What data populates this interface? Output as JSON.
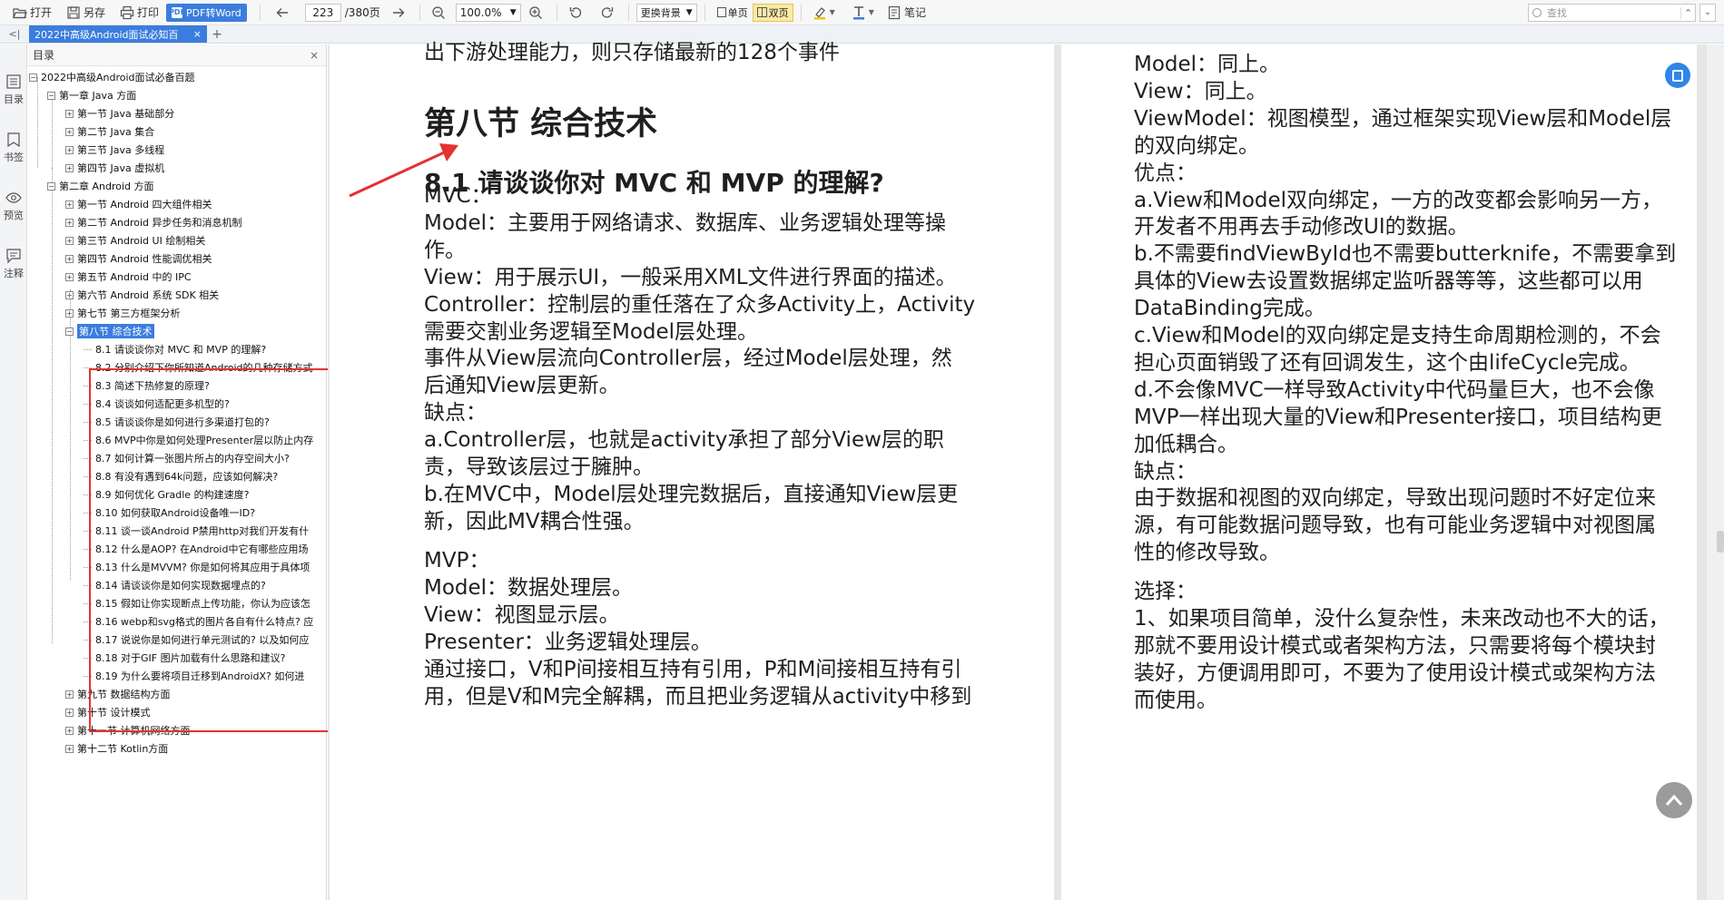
{
  "toolbar": {
    "open_label": "打开",
    "saveas_label": "另存",
    "print_label": "打印",
    "pdf_convert_label": "PDF转Word",
    "pdf_icon_text": "PDF",
    "current_page": "223",
    "total_pages": "/380页",
    "zoom": "100.0%",
    "background_label": "更换背景",
    "single_page_label": "单页",
    "double_page_label": "双页",
    "note_label": "笔记",
    "search_placeholder": "查找"
  },
  "tab": {
    "title": "2022中高级Android面试必知百",
    "close": "×",
    "new": "+"
  },
  "rail": {
    "toc": "目录",
    "bookmark": "书签",
    "preview": "预览",
    "annotate": "注释"
  },
  "toc": {
    "header": "目录",
    "close": "×",
    "root": "2022中高级Android面试必备百题",
    "chapter1": "第一章 Java 方面",
    "ch1_items": [
      "第一节 Java 基础部分",
      "第二节 Java 集合",
      "第三节 Java 多线程",
      "第四节 Java 虚拟机"
    ],
    "chapter2": "第二章 Android 方面",
    "ch2_items": [
      "第一节 Android 四大组件相关",
      "第二节 Android 异步任务和消息机制",
      "第三节 Android UI 绘制相关",
      "第四节 Android 性能调优相关",
      "第五节 Android 中的 IPC",
      "第六节 Android 系统 SDK 相关",
      "第七节 第三方框架分析"
    ],
    "section8": "第八节 综合技术",
    "sec8_items": [
      "8.1 请谈谈你对 MVC 和 MVP 的理解?",
      "8.2 分别介绍下你所知道Android的几种存储方式",
      "8.3 简述下热修复的原理?",
      "8.4 谈谈如何适配更多机型的?",
      "8.5 请谈谈你是如何进行多渠道打包的?",
      "8.6 MVP中你是如何处理Presenter层以防止内存",
      "8.7 如何计算一张图片所占的内存空间大小?",
      "8.8 有没有遇到64k问题，应该如何解决?",
      "8.9 如何优化 Gradle 的构建速度?",
      "8.10 如何获取Android设备唯一ID?",
      "8.11 谈一谈Android P禁用http对我们开发有什",
      "8.12 什么是AOP? 在Android中它有哪些应用场",
      "8.13 什么是MVVM? 你是如何将其应用于具体项",
      "8.14 请谈谈你是如何实现数据埋点的?",
      "8.15 假如让你实现断点上传功能，你认为应该怎",
      "8.16 webp和svg格式的图片各自有什么特点? 应",
      "8.17 说说你是如何进行单元测试的? 以及如何应",
      "8.18 对于GIF 图片加载有什么思路和建议?",
      "8.19 为什么要将项目迁移到AndroidX? 如何进"
    ],
    "tail_items": [
      "第九节 数据结构方面",
      "第十节 设计模式",
      "第十一节 计算机网络方面",
      "第十二节 Kotlin方面"
    ]
  },
  "left_page": {
    "top_line": "出下游处理能力，则只存储最新的128个事件",
    "section_title": "第八节 综合技术",
    "question_title": "8.1 请谈谈你对 MVC 和 MVP 的理解?",
    "lines1": [
      "MVC：",
      "Model：主要用于网络请求、数据库、业务逻辑处理等操",
      "作。",
      "View：用于展示UI，一般采用XML文件进行界面的描述。",
      "Controller：控制层的重任落在了众多Activity上，Activity",
      "需要交割业务逻辑至Model层处理。",
      "事件从View层流向Controller层，经过Model层处理，然",
      "后通知View层更新。",
      "缺点：",
      "a.Controller层，也就是activity承担了部分View层的职",
      "责，导致该层过于臃肿。",
      "b.在MVC中，Model层处理完数据后，直接通知View层更",
      "新，因此MV耦合性强。"
    ],
    "lines2": [
      "MVP：",
      "Model：数据处理层。",
      "View：视图显示层。",
      "Presenter：业务逻辑处理层。",
      "通过接口，V和P间接相互持有引用，P和M间接相互持有引",
      "用，但是V和M完全解耦，而且把业务逻辑从activity中移到"
    ]
  },
  "right_page": {
    "lines1": [
      "Model：同上。",
      "View：同上。",
      "ViewModel：视图模型，通过框架实现View层和Model层",
      "的双向绑定。",
      "优点：",
      "a.View和Model双向绑定，一方的改变都会影响另一方，",
      "开发者不用再去手动修改UI的数据。",
      "b.不需要findViewById也不需要butterknife，不需要拿到",
      "具体的View去设置数据绑定监听器等等，这些都可以用",
      "DataBinding完成。",
      "c.View和Model的双向绑定是支持生命周期检测的，不会",
      "担心页面销毁了还有回调发生，这个由lifeCycle完成。",
      "d.不会像MVC一样导致Activity中代码量巨大，也不会像",
      "MVP一样出现大量的View和Presenter接口，项目结构更",
      "加低耦合。",
      "缺点：",
      "由于数据和视图的双向绑定，导致出现问题时不好定位来",
      "源，有可能数据问题导致，也有可能业务逻辑中对视图属",
      "性的修改导致。"
    ],
    "lines2": [
      "选择：",
      "1、如果项目简单，没什么复杂性，未来改动也不大的话，",
      "那就不要用设计模式或者架构方法，只需要将每个模块封",
      "装好，方便调用即可，不要为了使用设计模式或架构方法",
      "而使用。"
    ]
  },
  "colors": {
    "accent": "#3b7ddd",
    "annotation_red": "#e53131",
    "highlight_yellow": "#fbe9a6"
  }
}
